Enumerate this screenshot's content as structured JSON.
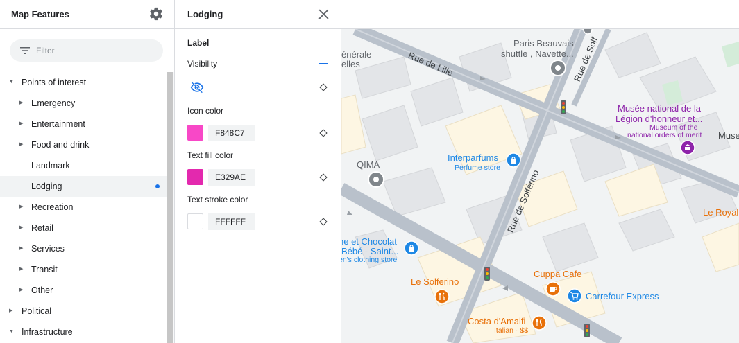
{
  "features_panel": {
    "title": "Map Features",
    "filter_placeholder": "Filter",
    "tree": [
      {
        "label": "Points of interest",
        "expanded": true
      },
      {
        "label": "Emergency"
      },
      {
        "label": "Entertainment"
      },
      {
        "label": "Food and drink"
      },
      {
        "label": "Landmark"
      },
      {
        "label": "Lodging",
        "selected": true
      },
      {
        "label": "Recreation"
      },
      {
        "label": "Retail"
      },
      {
        "label": "Services"
      },
      {
        "label": "Transit"
      },
      {
        "label": "Other"
      },
      {
        "label": "Political"
      },
      {
        "label": "Infrastructure",
        "expanded": true
      }
    ]
  },
  "style_panel": {
    "title": "Lodging",
    "section": "Label",
    "visibility_label": "Visibility",
    "icon_color_label": "Icon color",
    "icon_color_value": "F848C7",
    "icon_color_hex": "#F848C7",
    "text_fill_label": "Text fill color",
    "text_fill_value": "E329AE",
    "text_fill_hex": "#E329AE",
    "text_stroke_label": "Text stroke color",
    "text_stroke_value": "FFFFFF",
    "text_stroke_hex": "#FFFFFF",
    "accent_color": "#1a73e8"
  },
  "map": {
    "streets": {
      "lille": "Rue de Lille",
      "solferino_top": "Rue de Solf",
      "solferino": "Rue de Solférino"
    },
    "places": {
      "paris_beauvais_1": "Paris Beauvais",
      "paris_beauvais_2": "shuttle , Navette...",
      "musee_1": "Musée national de la",
      "musee_2": "Légion d'honneur et...",
      "musee_sub_1": "Museum of the",
      "musee_sub_2": "national orders of merit",
      "muse_edge": "Muse",
      "generale_1": "énérale",
      "generale_2": "elles",
      "qima": "QIMA",
      "interparfums": "Interparfums",
      "interparfums_sub": "Perfume store",
      "chocolat_1": "ne et Chocolat",
      "chocolat_2": "Bébé - Saint...",
      "chocolat_sub": "en's clothing store",
      "le_royal": "Le Royal",
      "le_solferino": "Le Solferino",
      "cuppa": "Cuppa Cafe",
      "carrefour": "Carrefour Express",
      "costa": "Costa d'Amalfi",
      "costa_sub": "Italian · $$"
    },
    "colors": {
      "shop_blue": "#1e88e5",
      "food_orange": "#e8710a",
      "museum_purple": "#8e24aa",
      "grey_pin": "#80868b"
    }
  }
}
